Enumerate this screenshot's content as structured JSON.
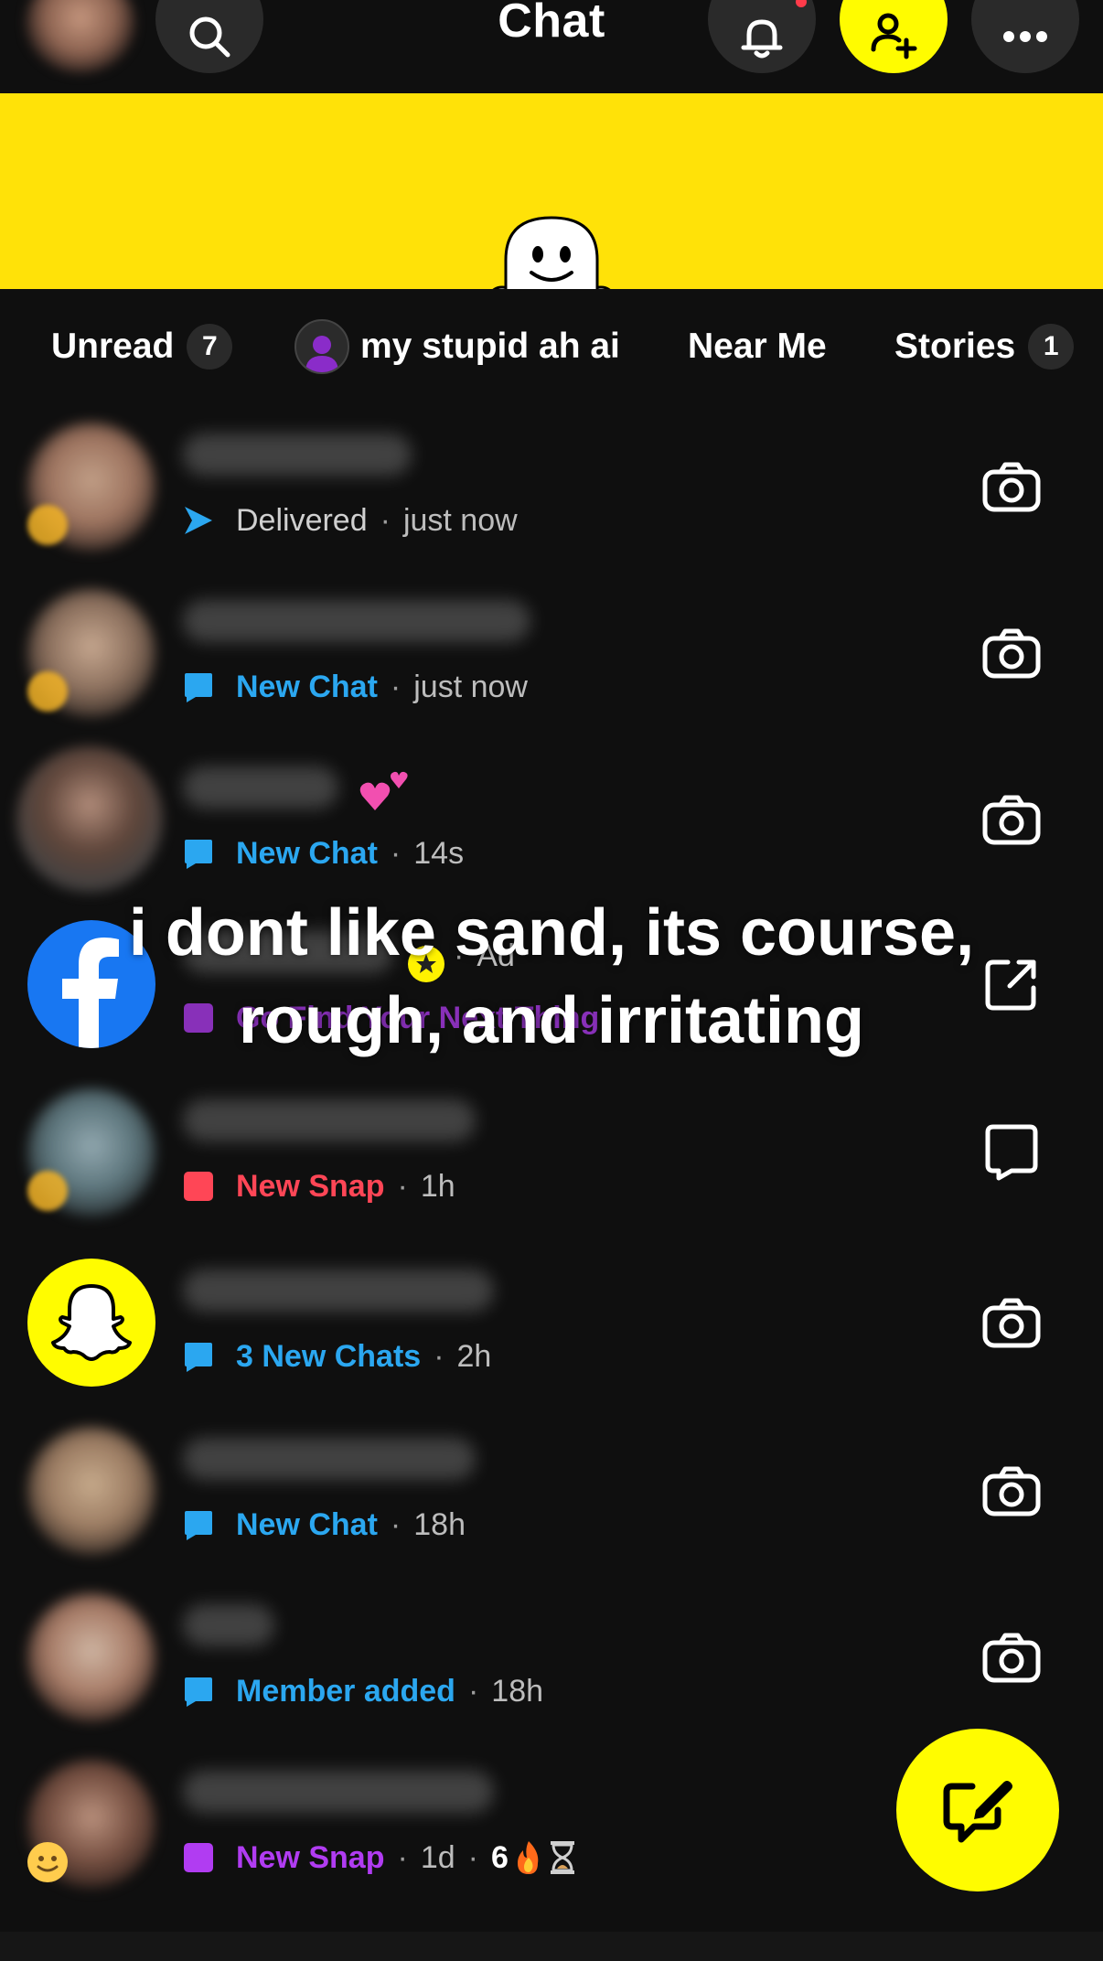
{
  "header": {
    "title": "Chat",
    "accent_color": "#fffc00"
  },
  "filters": [
    {
      "label": "Unread",
      "count": "7"
    },
    {
      "label": "my stupid ah ai"
    },
    {
      "label": "Near Me"
    },
    {
      "label": "Stories",
      "count": "1"
    }
  ],
  "chats": [
    {
      "status_label": "Delivered",
      "time": "just now",
      "status_icon": "delivered-arrow-icon",
      "color": "#bdbdbd",
      "action": "camera-icon"
    },
    {
      "status_label": "New Chat",
      "time": "just now",
      "status_icon": "chat-bubble-icon",
      "color": "#2ba7f0",
      "action": "camera-icon"
    },
    {
      "status_label": "New Chat",
      "time": "14s",
      "status_icon": "chat-bubble-icon",
      "color": "#2ba7f0",
      "action": "camera-icon"
    },
    {
      "ad_label": "Ad",
      "status_label": "Go Find Your Next Thing",
      "status_icon": "snap-square-icon",
      "color": "#b13cf2",
      "action": "external-link-icon"
    },
    {
      "status_label": "New Snap",
      "time": "1h",
      "status_icon": "snap-square-icon",
      "color": "#ff4656",
      "action": "chat-outline-icon"
    },
    {
      "status_label": "3 New Chats",
      "time": "2h",
      "status_icon": "chat-bubble-icon",
      "color": "#2ba7f0",
      "action": "camera-icon"
    },
    {
      "status_label": "New Chat",
      "time": "18h",
      "status_icon": "chat-bubble-icon",
      "color": "#2ba7f0",
      "action": "camera-icon"
    },
    {
      "status_label": "Member added",
      "time": "18h",
      "status_icon": "chat-bubble-icon",
      "color": "#2ba7f0",
      "action": "camera-icon"
    },
    {
      "status_label": "New Snap",
      "time": "1d",
      "streak": "6",
      "status_icon": "snap-square-icon",
      "color": "#b13cf2"
    }
  ],
  "caption": {
    "line1": "i dont like sand, its course,",
    "line2": "rough, and irritating"
  }
}
